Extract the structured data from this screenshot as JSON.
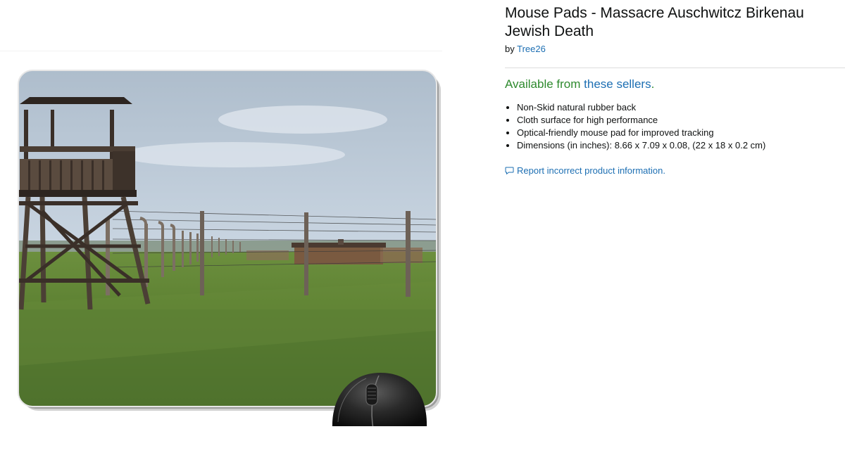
{
  "product": {
    "title": "Mouse Pads - Massacre Auschwitcz Birkenau Jewish Death",
    "by_prefix": "by",
    "brand": "Tree26",
    "availability_prefix": "Available from ",
    "availability_link": "these sellers",
    "availability_suffix": ".",
    "features": [
      "Non-Skid natural rubber back",
      "Cloth surface for high performance",
      "Optical-friendly mouse pad for improved tracking",
      "Dimensions (in inches): 8.66 x 7.09 x 0.08, (22 x 18 x 0.2 cm)"
    ],
    "report_link": "Report incorrect product information."
  },
  "icons": {
    "report": "speech-bubble-icon"
  },
  "colors": {
    "link": "#1d6fb3",
    "availability": "#2e8a2e",
    "text": "#0f1111"
  }
}
